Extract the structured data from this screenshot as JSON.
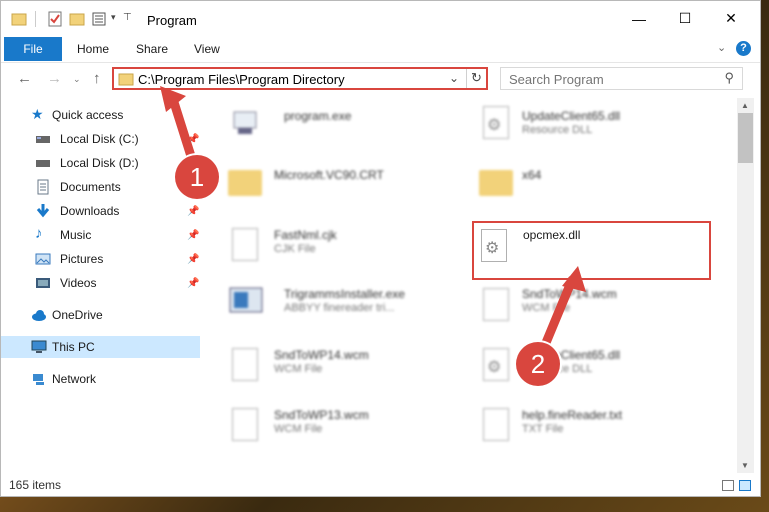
{
  "window": {
    "title": "Program",
    "controls": {
      "minimize": "—",
      "maximize": "☐",
      "close": "✕"
    }
  },
  "ribbon": {
    "tabs": [
      "File",
      "Home",
      "Share",
      "View"
    ],
    "help": "?"
  },
  "address": {
    "path": "C:\\Program Files\\Program Directory",
    "search_placeholder": "Search Program"
  },
  "sidebar": {
    "items": [
      {
        "label": "Quick access",
        "icon": "star-icon",
        "color": "#1979ca"
      },
      {
        "label": "Local Disk (C:)",
        "icon": "drive-icon",
        "color": "#555555"
      },
      {
        "label": "Local Disk (D:)",
        "icon": "drive-icon",
        "color": "#555555"
      },
      {
        "label": "Documents",
        "icon": "documents-icon",
        "color": "#6a7a8a"
      },
      {
        "label": "Downloads",
        "icon": "download-icon",
        "color": "#1979ca"
      },
      {
        "label": "Music",
        "icon": "music-icon",
        "color": "#1979ca"
      },
      {
        "label": "Pictures",
        "icon": "pictures-icon",
        "color": "#3a7abd"
      },
      {
        "label": "Videos",
        "icon": "videos-icon",
        "color": "#3a5a7a"
      },
      {
        "label": "OneDrive",
        "icon": "cloud-icon",
        "color": "#1979ca"
      },
      {
        "label": "This PC",
        "icon": "computer-icon",
        "color": "#3a8ad0"
      },
      {
        "label": "Network",
        "icon": "network-icon",
        "color": "#3a8ad0"
      }
    ]
  },
  "files": [
    {
      "name": "program.exe",
      "type": ""
    },
    {
      "name": "UpdateClient65.dll",
      "type": "Resource DLL"
    },
    {
      "name": "Microsoft.VC90.CRT",
      "type": ""
    },
    {
      "name": "x64",
      "type": ""
    },
    {
      "name": "FastNml.cjk",
      "type": "CJK File"
    },
    {
      "name": "opcmex.dll",
      "type": ""
    },
    {
      "name": "TrigrammsInstaller.exe",
      "type": "ABBYY finereader tri..."
    },
    {
      "name": "SndToWP14.wcm",
      "type": "WCM File"
    },
    {
      "name": "SndToWP14.wcm",
      "type": "WCM File"
    },
    {
      "name": "UpdateClient65.dll",
      "type": "Resource DLL"
    },
    {
      "name": "SndToWP13.wcm",
      "type": "WCM File"
    },
    {
      "name": "help.fineReader.txt",
      "type": "TXT File"
    }
  ],
  "status": {
    "count": "165 items"
  },
  "callouts": [
    "1",
    "2"
  ],
  "colors": {
    "accent": "#1979ca",
    "highlight": "#d9463e"
  }
}
